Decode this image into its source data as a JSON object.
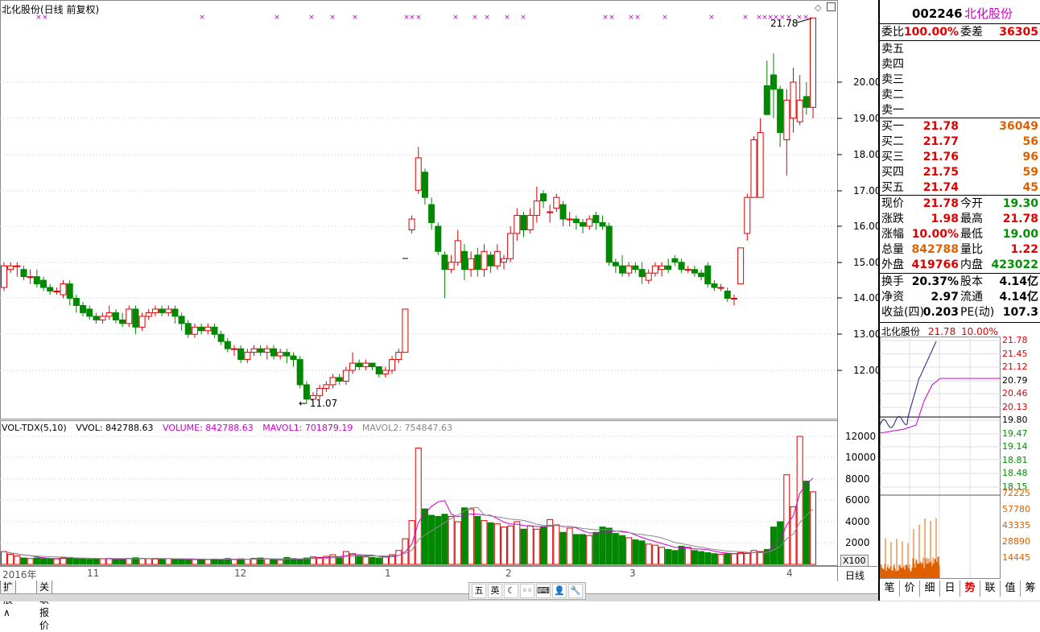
{
  "chart_title": "北化股份(日线 前复权)",
  "price_axis": [
    "20.00",
    "19.00",
    "18.00",
    "17.00",
    "16.00",
    "15.00",
    "14.00",
    "13.00",
    "12.00"
  ],
  "high_marker": "21.78",
  "low_marker": "11.07",
  "volume_legend": {
    "name": "VOL-TDX(5,10)",
    "vvol": "VVOL: 842788.63",
    "volume": "VOLUME: 842788.63",
    "mavol1": "MAVOL1: 701879.19",
    "mavol2": "MAVOL2: 754847.63"
  },
  "volume_axis": [
    "12000",
    "10000",
    "8000",
    "6000",
    "4000",
    "2000"
  ],
  "volume_unit": "X100",
  "date_axis": [
    "2016年",
    "11",
    "12",
    "1",
    "2",
    "3",
    "4"
  ],
  "period_button": "日线",
  "bottom_tabs": [
    "扩展∧",
    "关联报价"
  ],
  "toolbar_icons": [
    "五",
    "英",
    "☾",
    "◦◦",
    "⌨",
    "👤",
    "🔧"
  ],
  "colors": {
    "up": "#e00000",
    "down": "#009000",
    "ma": "#cc00cc",
    "grid": "#b0b0b0"
  },
  "chart_data": {
    "type": "candlestick",
    "title": "北化股份(日线 前复权)",
    "ylim": [
      11.0,
      22.0
    ],
    "high": 21.78,
    "low": 11.07,
    "last_close": 21.78,
    "volume": {
      "name": "VOL-TDX(5,10)",
      "VVOL": 842788.63,
      "VOLUME": 842788.63,
      "MAVOL1": 701879.19,
      "MAVOL2": 754847.63,
      "ylim": [
        0,
        13000
      ]
    }
  },
  "panel": {
    "code": "002246",
    "name": "北化股份",
    "weibi_label": "委比",
    "weibi": "100.00%",
    "weicha_label": "委差",
    "weicha": "36305",
    "sell": [
      "卖五",
      "卖四",
      "卖三",
      "卖二",
      "卖一"
    ],
    "buy": [
      {
        "label": "买一",
        "price": "21.78",
        "vol": "36049"
      },
      {
        "label": "买二",
        "price": "21.77",
        "vol": "56"
      },
      {
        "label": "买三",
        "price": "21.76",
        "vol": "96"
      },
      {
        "label": "买四",
        "price": "21.75",
        "vol": "59"
      },
      {
        "label": "买五",
        "price": "21.74",
        "vol": "45"
      }
    ],
    "quote": [
      {
        "l1": "现价",
        "v1": "21.78",
        "l2": "今开",
        "v2": "19.30"
      },
      {
        "l1": "涨跌",
        "v1": "1.98",
        "l2": "最高",
        "v2": "21.78"
      },
      {
        "l1": "涨幅",
        "v1": "10.00%",
        "l2": "最低",
        "v2": "19.00"
      },
      {
        "l1": "总量",
        "v1": "842788",
        "l2": "量比",
        "v2": "1.22"
      },
      {
        "l1": "外盘",
        "v1": "419766",
        "l2": "内盘",
        "v2": "423022"
      }
    ],
    "fin": [
      {
        "l1": "换手",
        "v1": "20.37%",
        "l2": "股本",
        "v2": "4.14亿"
      },
      {
        "l1": "净资",
        "v1": "2.97",
        "l2": "流通",
        "v2": "4.14亿"
      },
      {
        "l1": "收益(四)",
        "v1": "0.203",
        "l2": "PE(动)",
        "v2": "107.3"
      }
    ],
    "mini_title": "北化股份",
    "mini_price": "21.78",
    "mini_pct": "10.00%",
    "mini_axis": [
      "21.78",
      "21.45",
      "21.12",
      "20.79",
      "20.46",
      "20.13",
      "19.80",
      "19.47",
      "19.14",
      "18.81",
      "18.48",
      "18.15"
    ],
    "mini_vol_axis": [
      "72225",
      "57780",
      "43335",
      "28890",
      "14445"
    ],
    "tabs": [
      "笔",
      "价",
      "细",
      "日",
      "势",
      "联",
      "值",
      "筹"
    ]
  }
}
